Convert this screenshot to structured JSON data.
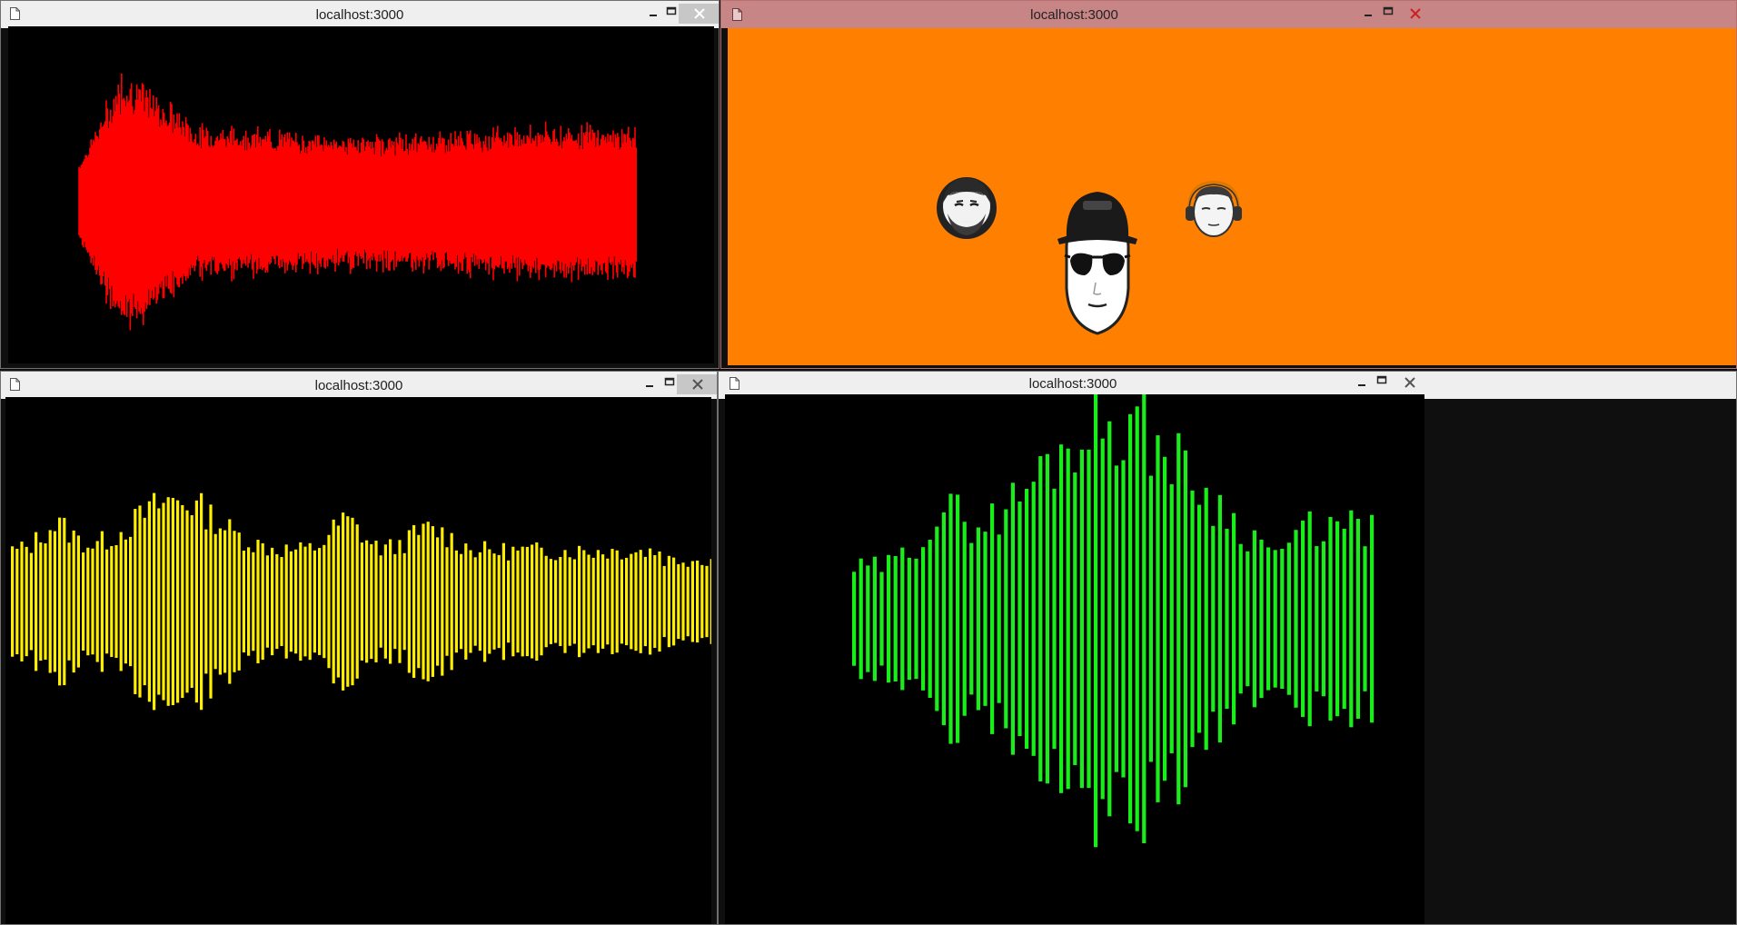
{
  "windows": [
    {
      "id": "top-left",
      "title": "localhost:3000",
      "active": false,
      "content_background": "#000000",
      "visualizer": {
        "type": "waveform",
        "color": "#ff0000",
        "style": "dense-lines"
      }
    },
    {
      "id": "top-right",
      "title": "localhost:3000",
      "active": true,
      "content_background": "#ff8000",
      "avatars": [
        {
          "name": "bearded-man-avatar",
          "description": "man with beard"
        },
        {
          "name": "sunglasses-cap-avatar",
          "description": "man with cap and sunglasses"
        },
        {
          "name": "headphones-avatar",
          "description": "man with headphones"
        }
      ]
    },
    {
      "id": "bottom-left",
      "title": "localhost:3000",
      "active": false,
      "content_background": "#000000",
      "visualizer": {
        "type": "bars",
        "color": "#ffee00",
        "style": "thin-bars"
      }
    },
    {
      "id": "bottom-right",
      "title": "localhost:3000",
      "active": false,
      "content_background": "#000000",
      "visualizer": {
        "type": "bars",
        "color": "#1aee1a",
        "style": "spaced-bars"
      }
    }
  ],
  "icons": {
    "document": "document-icon",
    "minimize": "minimize-icon",
    "maximize": "maximize-icon",
    "close": "close-icon"
  }
}
